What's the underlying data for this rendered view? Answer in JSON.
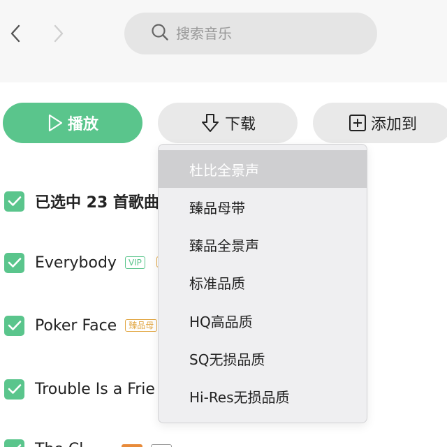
{
  "search": {
    "placeholder": "搜索音乐"
  },
  "actions": {
    "play_label": "播放",
    "download_label": "下载",
    "add_to_label": "添加到"
  },
  "selection": {
    "summary": "已选中 23 首歌曲"
  },
  "songs": [
    {
      "title": "Everybody",
      "badge": "VIP"
    },
    {
      "title": "Poker Face",
      "badge": "臻品母"
    },
    {
      "title": "Trouble Is a Frie"
    },
    {
      "title": "The Cl"
    }
  ],
  "download_menu": {
    "items": [
      {
        "label": "杜比全景声",
        "active": true
      },
      {
        "label": "臻品母带"
      },
      {
        "label": "臻品全景声"
      },
      {
        "label": "标准品质"
      },
      {
        "label": "HQ高品质"
      },
      {
        "label": "SQ无损品质"
      },
      {
        "label": "Hi-Res无损品质"
      }
    ]
  },
  "colors": {
    "accent": "#5ac58c",
    "button_bg": "#e9e9e9",
    "menu_bg": "#efeff1",
    "menu_active": "#cfcfd1",
    "gold_badge": "#e2a744"
  },
  "icons": [
    "back-arrow-icon",
    "forward-arrow-icon",
    "search-icon",
    "play-icon",
    "download-icon",
    "add-box-icon",
    "check-icon"
  ]
}
